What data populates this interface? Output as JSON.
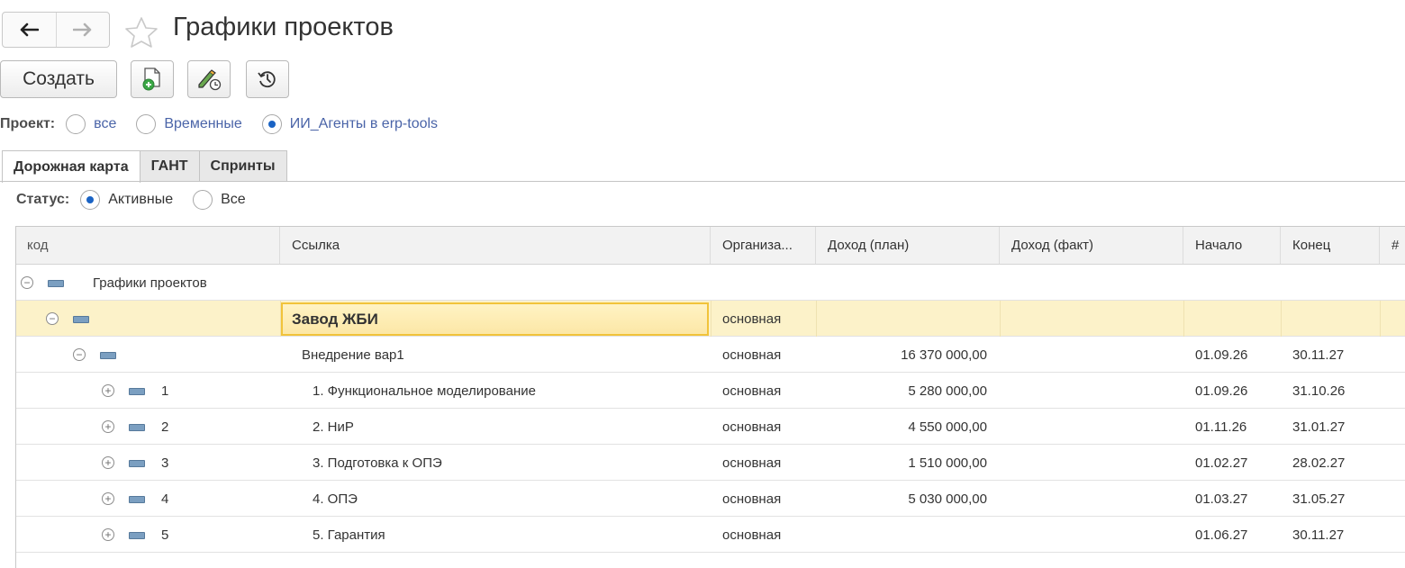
{
  "window": {
    "title": "Графики проектов"
  },
  "toolbar": {
    "create_label": "Создать"
  },
  "project_filter": {
    "label": "Проект:",
    "options": [
      "все",
      "Временные",
      "ИИ_Агенты в erp-tools"
    ],
    "selected": "ИИ_Агенты в erp-tools"
  },
  "tabs": [
    "Дорожная карта",
    "ГАНТ",
    "Спринты"
  ],
  "active_tab": "Дорожная карта",
  "status_filter": {
    "label": "Статус:",
    "options": [
      "Активные",
      "Все"
    ],
    "selected": "Активные"
  },
  "table": {
    "columns": [
      "код",
      "Ссылка",
      "Организа...",
      "Доход (план)",
      "Доход (факт)",
      "Начало",
      "Конец",
      "#"
    ],
    "rows": [
      {
        "level": 0,
        "toggle": "−",
        "code": "Графики проектов",
        "link": "",
        "org": "",
        "plan": "",
        "fact": "",
        "start": "",
        "end": ""
      },
      {
        "level": 1,
        "toggle": "−",
        "code": "",
        "link": "Завод ЖБИ",
        "org": "основная",
        "plan": "",
        "fact": "",
        "start": "",
        "end": "",
        "selected": true
      },
      {
        "level": 2,
        "toggle": "−",
        "code": "",
        "link": "Внедрение вар1",
        "org": "основная",
        "plan": "16 370 000,00",
        "fact": "",
        "start": "01.09.26",
        "end": "30.11.27"
      },
      {
        "level": 3,
        "toggle": "+",
        "code": "1",
        "link": "1. Функциональное моделирование",
        "org": "основная",
        "plan": "5 280 000,00",
        "fact": "",
        "start": "01.09.26",
        "end": "31.10.26"
      },
      {
        "level": 3,
        "toggle": "+",
        "code": "2",
        "link": "2. НиР",
        "org": "основная",
        "plan": "4 550 000,00",
        "fact": "",
        "start": "01.11.26",
        "end": "31.01.27"
      },
      {
        "level": 3,
        "toggle": "+",
        "code": "3",
        "link": "3. Подготовка к ОПЭ",
        "org": "основная",
        "plan": "1 510 000,00",
        "fact": "",
        "start": "01.02.27",
        "end": "28.02.27"
      },
      {
        "level": 3,
        "toggle": "+",
        "code": "4",
        "link": "4. ОПЭ",
        "org": "основная",
        "plan": "5 030 000,00",
        "fact": "",
        "start": "01.03.27",
        "end": "31.05.27"
      },
      {
        "level": 3,
        "toggle": "+",
        "code": "5",
        "link": "5. Гарантия",
        "org": "основная",
        "plan": "",
        "fact": "",
        "start": "01.06.27",
        "end": "30.11.27"
      }
    ]
  },
  "icons": {
    "back": "arrow-left-icon",
    "forward": "arrow-right-icon",
    "favorite": "star-icon",
    "new_doc": "document-add-icon",
    "edit_history": "pencil-clock-icon",
    "history": "history-icon"
  },
  "colors": {
    "accent_blue": "#1a63c4",
    "selection_border": "#f1c33a",
    "selected_row_bg": "#fcf2c9",
    "folder_icon": "#7b9fc1",
    "link_text": "#4a64a8"
  }
}
